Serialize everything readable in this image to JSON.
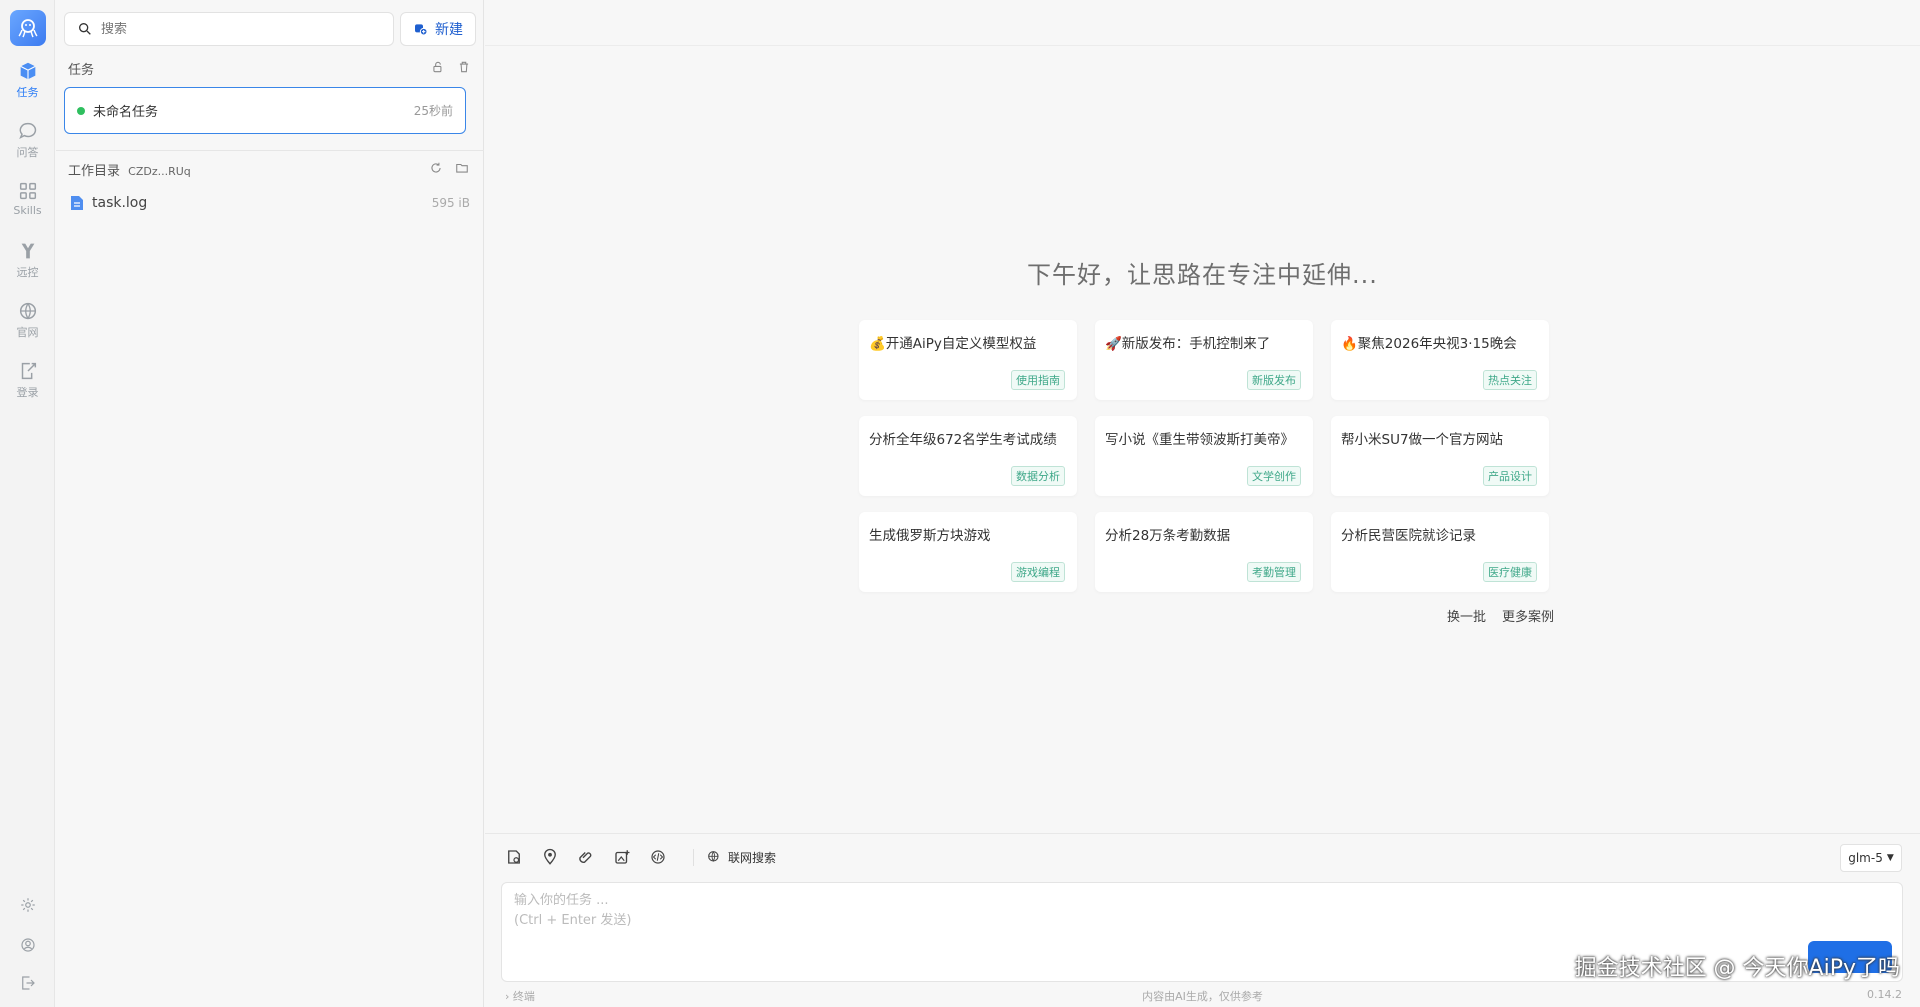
{
  "rail": {
    "items": [
      {
        "label": "任务",
        "icon": "cube-icon"
      },
      {
        "label": "问答",
        "icon": "chat-icon"
      },
      {
        "label": "Skills",
        "icon": "grid-icon"
      },
      {
        "label": "远控",
        "icon": "remote-icon"
      },
      {
        "label": "官网",
        "icon": "globe-icon"
      },
      {
        "label": "登录",
        "icon": "login-icon"
      }
    ]
  },
  "panel": {
    "search_placeholder": "搜索",
    "new_label": "新建",
    "tasks_title": "任务",
    "tasks": [
      {
        "name": "未命名任务",
        "time": "25秒前"
      }
    ],
    "workdir_title": "工作目录",
    "workdir_id": "CZDz...RUq",
    "files": [
      {
        "name": "task.log",
        "size": "595 iB"
      }
    ]
  },
  "main": {
    "greeting": "下午好，让思路在专注中延伸...",
    "cards": [
      {
        "title": "💰开通AiPy自定义模型权益",
        "tag": "使用指南"
      },
      {
        "title": "🚀新版发布：手机控制来了",
        "tag": "新版发布"
      },
      {
        "title": "🔥聚焦2026年央视3·15晚会",
        "tag": "热点关注"
      },
      {
        "title": "分析全年级672名学生考试成绩",
        "tag": "数据分析"
      },
      {
        "title": "写小说《重生带领波斯打美帝》",
        "tag": "文学创作"
      },
      {
        "title": "帮小米SU7做一个官方网站",
        "tag": "产品设计"
      },
      {
        "title": "生成俄罗斯方块游戏",
        "tag": "游戏编程"
      },
      {
        "title": "分析28万条考勤数据",
        "tag": "考勤管理"
      },
      {
        "title": "分析民营医院就诊记录",
        "tag": "医疗健康"
      }
    ],
    "refresh_label": "换一批",
    "more_label": "更多案例"
  },
  "composer": {
    "web_search_label": "联网搜索",
    "model": "glm-5",
    "placeholder_line1": "输入你的任务 ...",
    "placeholder_line2": "(Ctrl + Enter 发送)"
  },
  "footer": {
    "left": "终端",
    "center": "内容由AI生成，仅供参考",
    "version": "0.14.2"
  },
  "watermark": "掘金技术社区 @ 今天你AiPy了吗",
  "colors": {
    "accent": "#2b7cf6",
    "tag": "#3fa889",
    "online": "#2fbf5f"
  }
}
